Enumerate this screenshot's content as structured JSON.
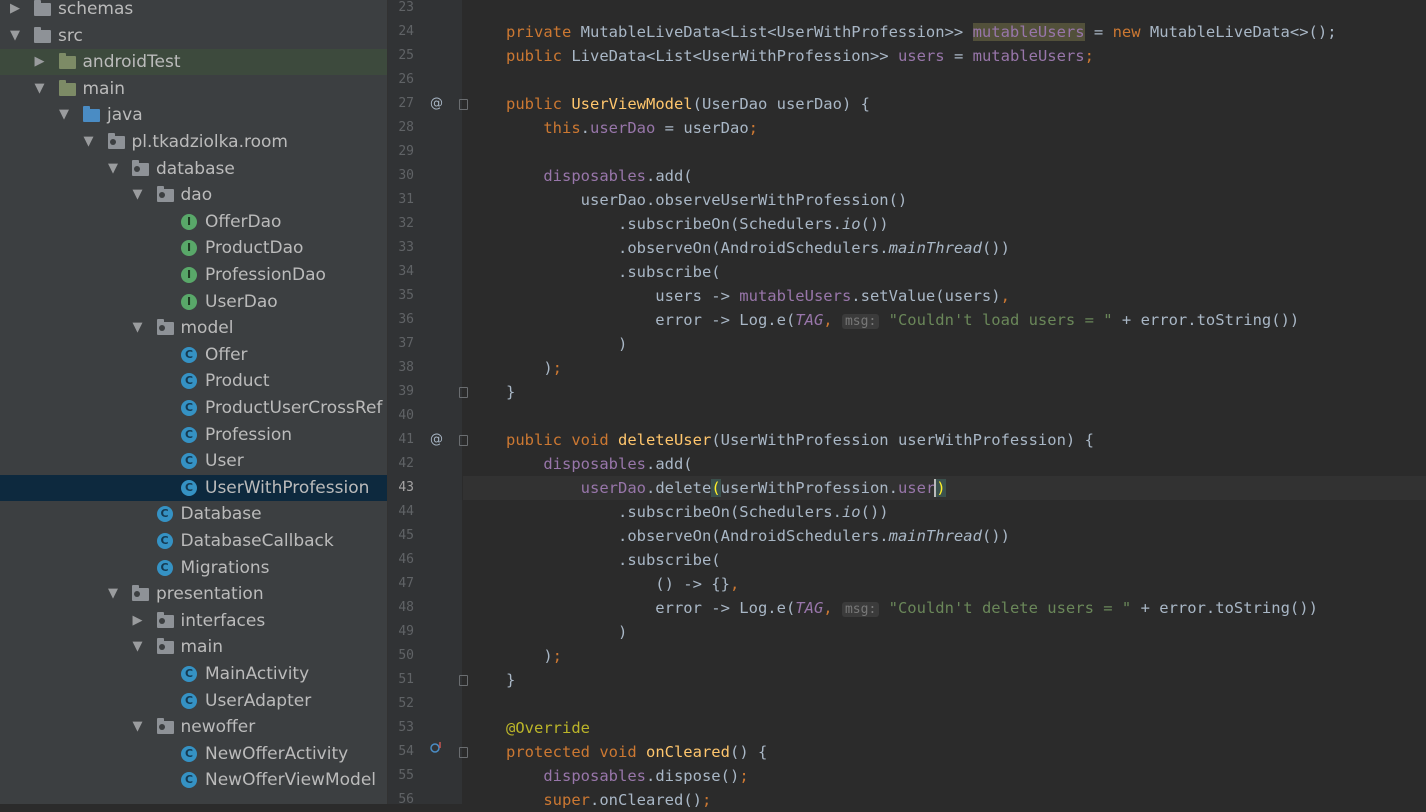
{
  "project_tree": [
    {
      "label": "schemas",
      "icon": "folder-icon",
      "depth": 0,
      "arrow": "▶",
      "state": ""
    },
    {
      "label": "src",
      "icon": "folder-icon",
      "depth": 0,
      "arrow": "▼",
      "state": ""
    },
    {
      "label": "androidTest",
      "icon": "test-folder-icon",
      "depth": 1,
      "arrow": "▶",
      "state": "highlight"
    },
    {
      "label": "main",
      "icon": "module-folder-icon",
      "depth": 1,
      "arrow": "▼",
      "state": ""
    },
    {
      "label": "java",
      "icon": "source-folder-icon",
      "depth": 2,
      "arrow": "▼",
      "state": ""
    },
    {
      "label": "pl.tkadziolka.room",
      "icon": "package-icon",
      "depth": 3,
      "arrow": "▼",
      "state": ""
    },
    {
      "label": "database",
      "icon": "package-icon",
      "depth": 4,
      "arrow": "▼",
      "state": ""
    },
    {
      "label": "dao",
      "icon": "package-icon",
      "depth": 5,
      "arrow": "▼",
      "state": ""
    },
    {
      "label": "OfferDao",
      "icon": "interface-icon",
      "depth": 6,
      "arrow": "",
      "state": ""
    },
    {
      "label": "ProductDao",
      "icon": "interface-icon",
      "depth": 6,
      "arrow": "",
      "state": ""
    },
    {
      "label": "ProfessionDao",
      "icon": "interface-icon",
      "depth": 6,
      "arrow": "",
      "state": ""
    },
    {
      "label": "UserDao",
      "icon": "interface-icon",
      "depth": 6,
      "arrow": "",
      "state": ""
    },
    {
      "label": "model",
      "icon": "package-icon",
      "depth": 5,
      "arrow": "▼",
      "state": ""
    },
    {
      "label": "Offer",
      "icon": "class-icon",
      "depth": 6,
      "arrow": "",
      "state": ""
    },
    {
      "label": "Product",
      "icon": "class-icon",
      "depth": 6,
      "arrow": "",
      "state": ""
    },
    {
      "label": "ProductUserCrossRef",
      "icon": "class-icon",
      "depth": 6,
      "arrow": "",
      "state": ""
    },
    {
      "label": "Profession",
      "icon": "class-icon",
      "depth": 6,
      "arrow": "",
      "state": ""
    },
    {
      "label": "User",
      "icon": "class-icon",
      "depth": 6,
      "arrow": "",
      "state": ""
    },
    {
      "label": "UserWithProfession",
      "icon": "class-icon",
      "depth": 6,
      "arrow": "",
      "state": "selected"
    },
    {
      "label": "Database",
      "icon": "class-icon",
      "depth": 5,
      "arrow": "",
      "state": ""
    },
    {
      "label": "DatabaseCallback",
      "icon": "class-icon",
      "depth": 5,
      "arrow": "",
      "state": ""
    },
    {
      "label": "Migrations",
      "icon": "class-icon",
      "depth": 5,
      "arrow": "",
      "state": ""
    },
    {
      "label": "presentation",
      "icon": "package-icon",
      "depth": 4,
      "arrow": "▼",
      "state": ""
    },
    {
      "label": "interfaces",
      "icon": "package-icon",
      "depth": 5,
      "arrow": "▶",
      "state": ""
    },
    {
      "label": "main",
      "icon": "package-icon",
      "depth": 5,
      "arrow": "▼",
      "state": ""
    },
    {
      "label": "MainActivity",
      "icon": "class-icon",
      "depth": 6,
      "arrow": "",
      "state": ""
    },
    {
      "label": "UserAdapter",
      "icon": "class-icon",
      "depth": 6,
      "arrow": "",
      "state": ""
    },
    {
      "label": "newoffer",
      "icon": "package-icon",
      "depth": 5,
      "arrow": "▼",
      "state": ""
    },
    {
      "label": "NewOfferActivity",
      "icon": "class-icon",
      "depth": 6,
      "arrow": "",
      "state": ""
    },
    {
      "label": "NewOfferViewModel",
      "icon": "class-icon",
      "depth": 6,
      "arrow": "",
      "state": ""
    }
  ],
  "editor": {
    "current_line": 43,
    "lines": [
      {
        "n": 23,
        "segs": []
      },
      {
        "n": 24,
        "segs": [
          {
            "t": "private ",
            "c": "kw"
          },
          {
            "t": "MutableLiveData<List<UserWithProfession>> "
          },
          {
            "t": "mutableUsers",
            "c": "fld occ"
          },
          {
            "t": " = "
          },
          {
            "t": "new ",
            "c": "kw"
          },
          {
            "t": "MutableLiveData<>();"
          }
        ]
      },
      {
        "n": 25,
        "segs": [
          {
            "t": "public ",
            "c": "kw"
          },
          {
            "t": "LiveData<List<UserWithProfession>> "
          },
          {
            "t": "users",
            "c": "fld"
          },
          {
            "t": " = "
          },
          {
            "t": "mutableUsers",
            "c": "fld"
          },
          {
            "t": ";",
            "c": "kw"
          }
        ]
      },
      {
        "n": 26,
        "segs": []
      },
      {
        "n": 27,
        "mark": "@",
        "segs": [
          {
            "t": "public ",
            "c": "kw"
          },
          {
            "t": "UserViewModel",
            "c": "mth"
          },
          {
            "t": "(UserDao userDao) {"
          }
        ]
      },
      {
        "n": 28,
        "segs": [
          {
            "t": "    "
          },
          {
            "t": "this",
            "c": "kw"
          },
          {
            "t": "."
          },
          {
            "t": "userDao",
            "c": "fld"
          },
          {
            "t": " = userDao"
          },
          {
            "t": ";",
            "c": "kw"
          }
        ]
      },
      {
        "n": 29,
        "segs": []
      },
      {
        "n": 30,
        "segs": [
          {
            "t": "    "
          },
          {
            "t": "disposables",
            "c": "fld"
          },
          {
            "t": ".add("
          }
        ]
      },
      {
        "n": 31,
        "segs": [
          {
            "t": "        userDao.observeUserWithProfession()"
          }
        ]
      },
      {
        "n": 32,
        "segs": [
          {
            "t": "            .subscribeOn(Schedulers."
          },
          {
            "t": "io",
            "c": "ital"
          },
          {
            "t": "())"
          }
        ]
      },
      {
        "n": 33,
        "segs": [
          {
            "t": "            .observeOn(AndroidSchedulers."
          },
          {
            "t": "mainThread",
            "c": "ital"
          },
          {
            "t": "())"
          }
        ]
      },
      {
        "n": 34,
        "segs": [
          {
            "t": "            .subscribe("
          }
        ]
      },
      {
        "n": 35,
        "segs": [
          {
            "t": "                users -> "
          },
          {
            "t": "mutableUsers",
            "c": "fld"
          },
          {
            "t": ".setValue(users)"
          },
          {
            "t": ",",
            "c": "kw"
          }
        ]
      },
      {
        "n": 36,
        "segs": [
          {
            "t": "                error -> Log.e("
          },
          {
            "t": "TAG",
            "c": "fld ital"
          },
          {
            "t": ", ",
            "c": "kw"
          },
          {
            "t": "msg:",
            "c": "hint"
          },
          {
            "t": " "
          },
          {
            "t": "\"Couldn't load users = \"",
            "c": "str"
          },
          {
            "t": " + error.toString())"
          }
        ]
      },
      {
        "n": 37,
        "segs": [
          {
            "t": "            )"
          }
        ]
      },
      {
        "n": 38,
        "segs": [
          {
            "t": "    )"
          },
          {
            "t": ";",
            "c": "kw"
          }
        ]
      },
      {
        "n": 39,
        "segs": [
          {
            "t": "}"
          }
        ]
      },
      {
        "n": 40,
        "segs": []
      },
      {
        "n": 41,
        "mark": "@",
        "segs": [
          {
            "t": "public void ",
            "c": "kw"
          },
          {
            "t": "deleteUser",
            "c": "mth"
          },
          {
            "t": "(UserWithProfession userWithProfession) {"
          }
        ]
      },
      {
        "n": 42,
        "segs": [
          {
            "t": "    "
          },
          {
            "t": "disposables",
            "c": "fld"
          },
          {
            "t": ".add("
          }
        ]
      },
      {
        "n": 43,
        "segs": [
          {
            "t": "        "
          },
          {
            "t": "userDao",
            "c": "fld"
          },
          {
            "t": ".delete"
          },
          {
            "t": "(",
            "c": "paren"
          },
          {
            "t": "userWithProfession."
          },
          {
            "t": "user",
            "c": "fld"
          },
          {
            "t": ")",
            "c": "paren caret"
          }
        ]
      },
      {
        "n": 44,
        "segs": [
          {
            "t": "            .subscribeOn(Schedulers."
          },
          {
            "t": "io",
            "c": "ital"
          },
          {
            "t": "())"
          }
        ]
      },
      {
        "n": 45,
        "segs": [
          {
            "t": "            .observeOn(AndroidSchedulers."
          },
          {
            "t": "mainThread",
            "c": "ital"
          },
          {
            "t": "())"
          }
        ]
      },
      {
        "n": 46,
        "segs": [
          {
            "t": "            .subscribe("
          }
        ]
      },
      {
        "n": 47,
        "segs": [
          {
            "t": "                () -> {}"
          },
          {
            "t": ",",
            "c": "kw"
          }
        ]
      },
      {
        "n": 48,
        "segs": [
          {
            "t": "                error -> Log.e("
          },
          {
            "t": "TAG",
            "c": "fld ital"
          },
          {
            "t": ", ",
            "c": "kw"
          },
          {
            "t": "msg:",
            "c": "hint"
          },
          {
            "t": " "
          },
          {
            "t": "\"Couldn't delete users = \"",
            "c": "str"
          },
          {
            "t": " + error.toString())"
          }
        ]
      },
      {
        "n": 49,
        "segs": [
          {
            "t": "            )"
          }
        ]
      },
      {
        "n": 50,
        "segs": [
          {
            "t": "    )"
          },
          {
            "t": ";",
            "c": "kw"
          }
        ]
      },
      {
        "n": 51,
        "segs": [
          {
            "t": "}"
          }
        ]
      },
      {
        "n": 52,
        "segs": []
      },
      {
        "n": 53,
        "segs": [
          {
            "t": "@Override",
            "c": "ann"
          }
        ]
      },
      {
        "n": 54,
        "mark": "override-icon",
        "segs": [
          {
            "t": "protected void ",
            "c": "kw"
          },
          {
            "t": "onCleared",
            "c": "mth"
          },
          {
            "t": "() {"
          }
        ]
      },
      {
        "n": 55,
        "segs": [
          {
            "t": "    "
          },
          {
            "t": "disposables",
            "c": "fld"
          },
          {
            "t": ".dispose()"
          },
          {
            "t": ";",
            "c": "kw"
          }
        ]
      },
      {
        "n": 56,
        "segs": [
          {
            "t": "    "
          },
          {
            "t": "super",
            "c": "kw"
          },
          {
            "t": ".onCleared()"
          },
          {
            "t": ";",
            "c": "kw"
          }
        ]
      }
    ]
  }
}
